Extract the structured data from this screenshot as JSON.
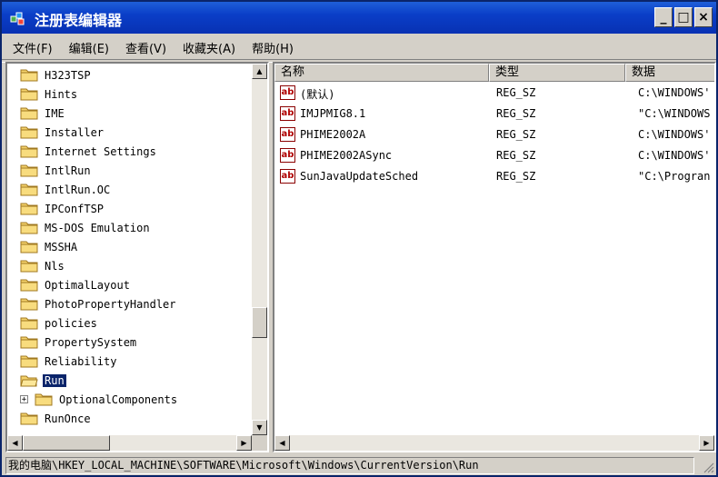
{
  "window": {
    "title": "注册表编辑器",
    "controls": {
      "minimize": "_",
      "maximize": "□",
      "close": "×"
    }
  },
  "menu": [
    "文件(F)",
    "编辑(E)",
    "查看(V)",
    "收藏夹(A)",
    "帮助(H)"
  ],
  "tree": {
    "items": [
      {
        "label": "H323TSP"
      },
      {
        "label": "Hints"
      },
      {
        "label": "IME"
      },
      {
        "label": "Installer"
      },
      {
        "label": "Internet Settings"
      },
      {
        "label": "IntlRun"
      },
      {
        "label": "IntlRun.OC"
      },
      {
        "label": "IPConfTSP"
      },
      {
        "label": "MS-DOS Emulation"
      },
      {
        "label": "MSSHA"
      },
      {
        "label": "Nls"
      },
      {
        "label": "OptimalLayout"
      },
      {
        "label": "PhotoPropertyHandler"
      },
      {
        "label": "policies"
      },
      {
        "label": "PropertySystem"
      },
      {
        "label": "Reliability"
      },
      {
        "label": "Run",
        "selected": true
      },
      {
        "label": "OptionalComponents",
        "child": true
      },
      {
        "label": "RunOnce"
      }
    ]
  },
  "list": {
    "columns": [
      "名称",
      "类型",
      "数据"
    ],
    "rows": [
      {
        "name": "(默认)",
        "type": "REG_SZ",
        "data": "C:\\WINDOWS'"
      },
      {
        "name": "IMJPMIG8.1",
        "type": "REG_SZ",
        "data": "\"C:\\WINDOWS"
      },
      {
        "name": "PHIME2002A",
        "type": "REG_SZ",
        "data": "C:\\WINDOWS'"
      },
      {
        "name": "PHIME2002ASync",
        "type": "REG_SZ",
        "data": "C:\\WINDOWS'"
      },
      {
        "name": "SunJavaUpdateSched",
        "type": "REG_SZ",
        "data": "\"C:\\Progran"
      }
    ]
  },
  "status": {
    "path": "我的电脑\\HKEY_LOCAL_MACHINE\\SOFTWARE\\Microsoft\\Windows\\CurrentVersion\\Run"
  },
  "colors": {
    "titlebar": "#0a3ec8",
    "selection": "#0a246a",
    "chrome": "#d4d0c8"
  },
  "icons": {
    "folder": "folder-icon",
    "open_folder": "open-folder-icon",
    "string_value": "reg-sz-icon"
  }
}
